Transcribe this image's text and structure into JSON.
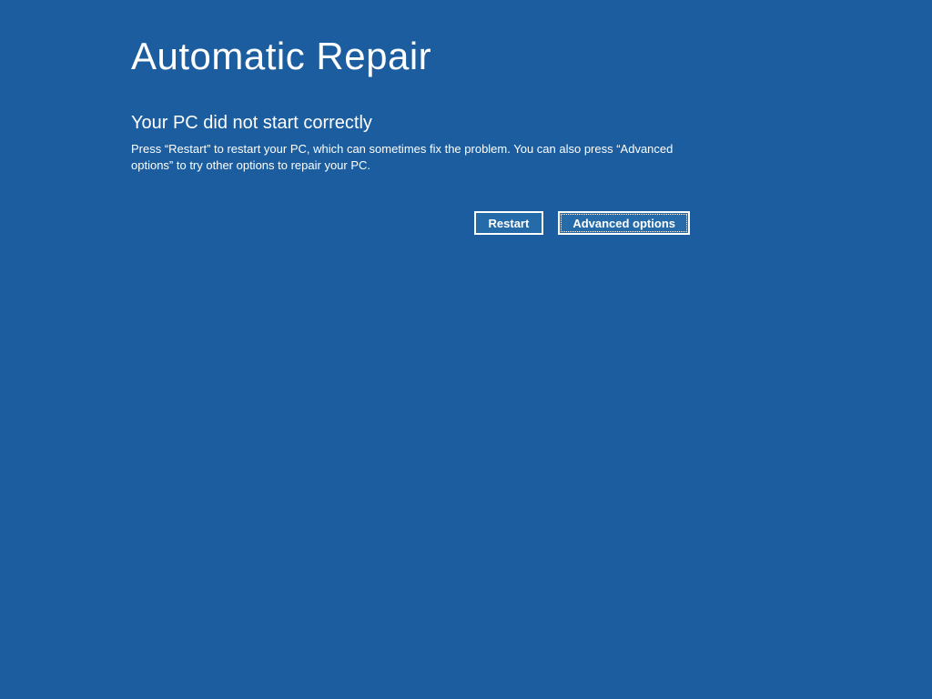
{
  "title": "Automatic Repair",
  "subtitle": "Your PC did not start correctly",
  "description": "Press “Restart” to restart your PC, which can sometimes fix the problem. You can also press “Advanced options” to try other options to repair your PC.",
  "buttons": {
    "restart": "Restart",
    "advanced": "Advanced options"
  }
}
